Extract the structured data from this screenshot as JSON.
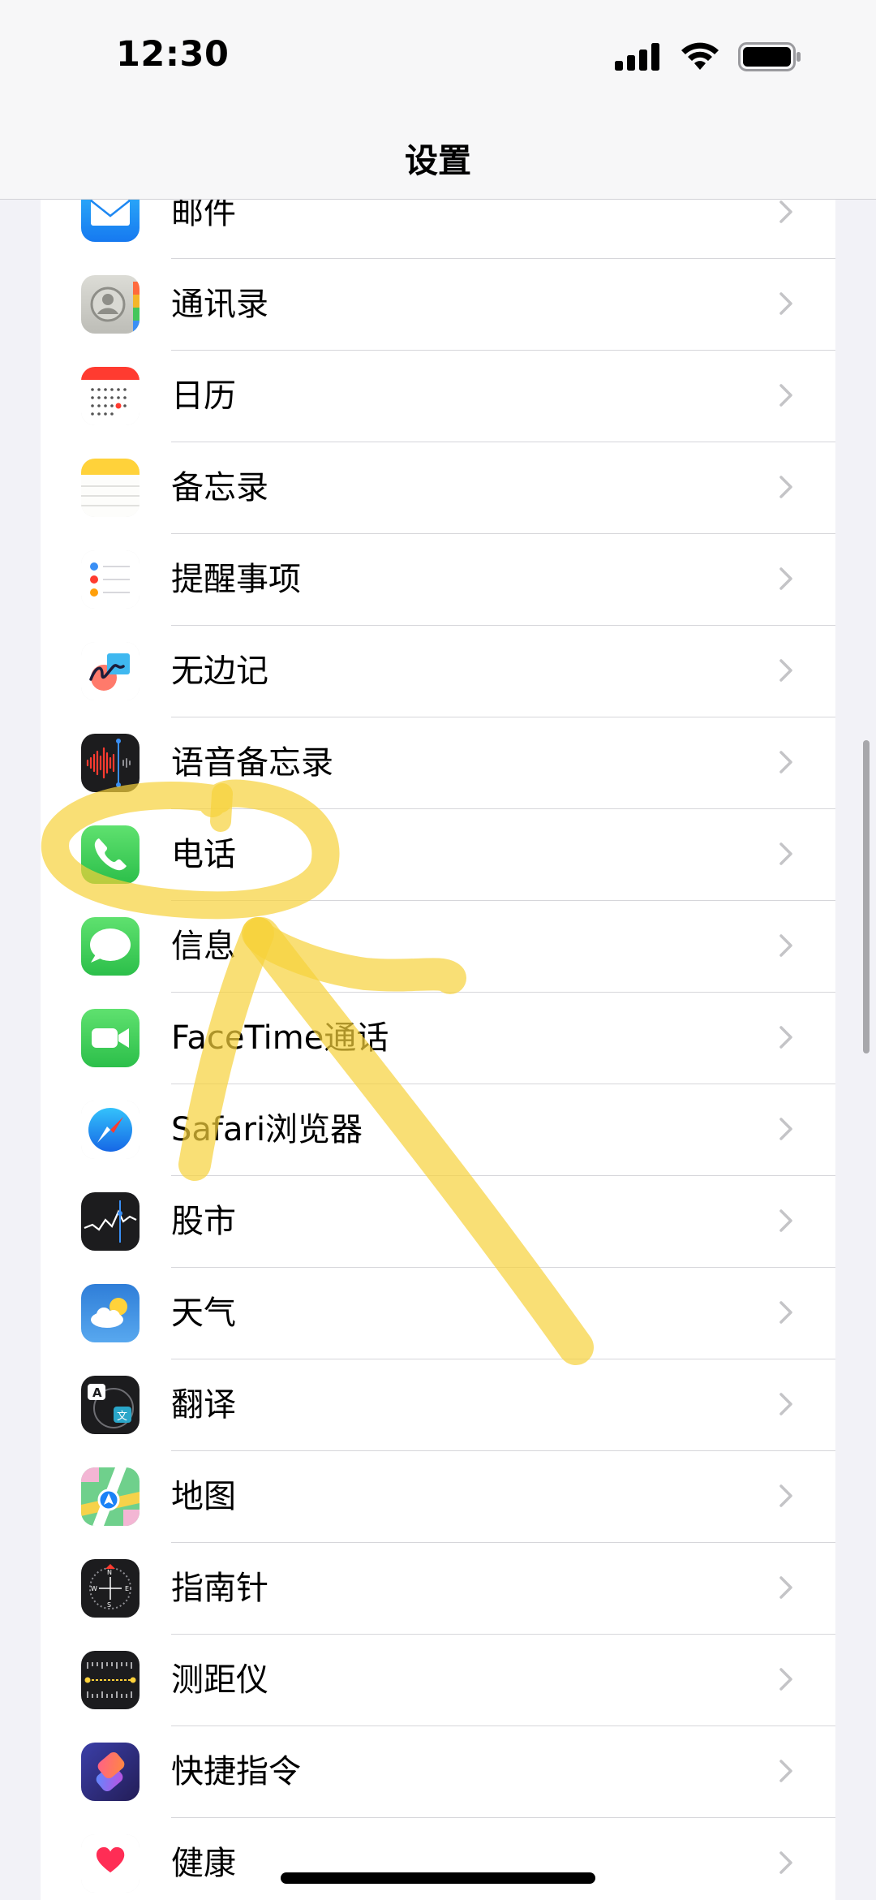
{
  "status_bar": {
    "time": "12:30",
    "icons": [
      "cellular-signal-icon",
      "wifi-icon",
      "battery-icon"
    ]
  },
  "nav": {
    "title": "设置"
  },
  "settings_items": [
    {
      "label": "邮件",
      "icon": "mail-icon",
      "color": "#1e90f7"
    },
    {
      "label": "通讯录",
      "icon": "contacts-icon",
      "color": "#c9c9c4"
    },
    {
      "label": "日历",
      "icon": "calendar-icon",
      "color": "#ff3b30"
    },
    {
      "label": "备忘录",
      "icon": "notes-icon",
      "color": "#ffd60a"
    },
    {
      "label": "提醒事项",
      "icon": "reminders-icon",
      "color": "#ffffff"
    },
    {
      "label": "无边记",
      "icon": "freeform-icon",
      "color": "#ffffff"
    },
    {
      "label": "语音备忘录",
      "icon": "voice-memos-icon",
      "color": "#1c1c1e"
    },
    {
      "label": "电话",
      "icon": "phone-icon",
      "color": "#34c759"
    },
    {
      "label": "信息",
      "icon": "messages-icon",
      "color": "#34c759"
    },
    {
      "label": "FaceTime通话",
      "icon": "facetime-icon",
      "color": "#34c759"
    },
    {
      "label": "Safari浏览器",
      "icon": "safari-compass-icon",
      "color": "#1a82f7"
    },
    {
      "label": "股市",
      "icon": "stocks-icon",
      "color": "#1c1c1e"
    },
    {
      "label": "天气",
      "icon": "weather-icon",
      "color": "#3d8fe0"
    },
    {
      "label": "翻译",
      "icon": "translate-icon",
      "color": "#1c1c1e"
    },
    {
      "label": "地图",
      "icon": "maps-icon",
      "color": "#6fd08c"
    },
    {
      "label": "指南针",
      "icon": "compass-icon",
      "color": "#1c1c1e"
    },
    {
      "label": "测距仪",
      "icon": "measure-icon",
      "color": "#1c1c1e"
    },
    {
      "label": "快捷指令",
      "icon": "shortcuts-icon",
      "color": "#5a3fd6"
    },
    {
      "label": "健康",
      "icon": "health-heart-icon",
      "color": "#ff2d55"
    }
  ],
  "annotation": {
    "color": "#f7d23a",
    "shapes": [
      "circle-around-phone",
      "arrow-pointing-to-phone"
    ]
  }
}
